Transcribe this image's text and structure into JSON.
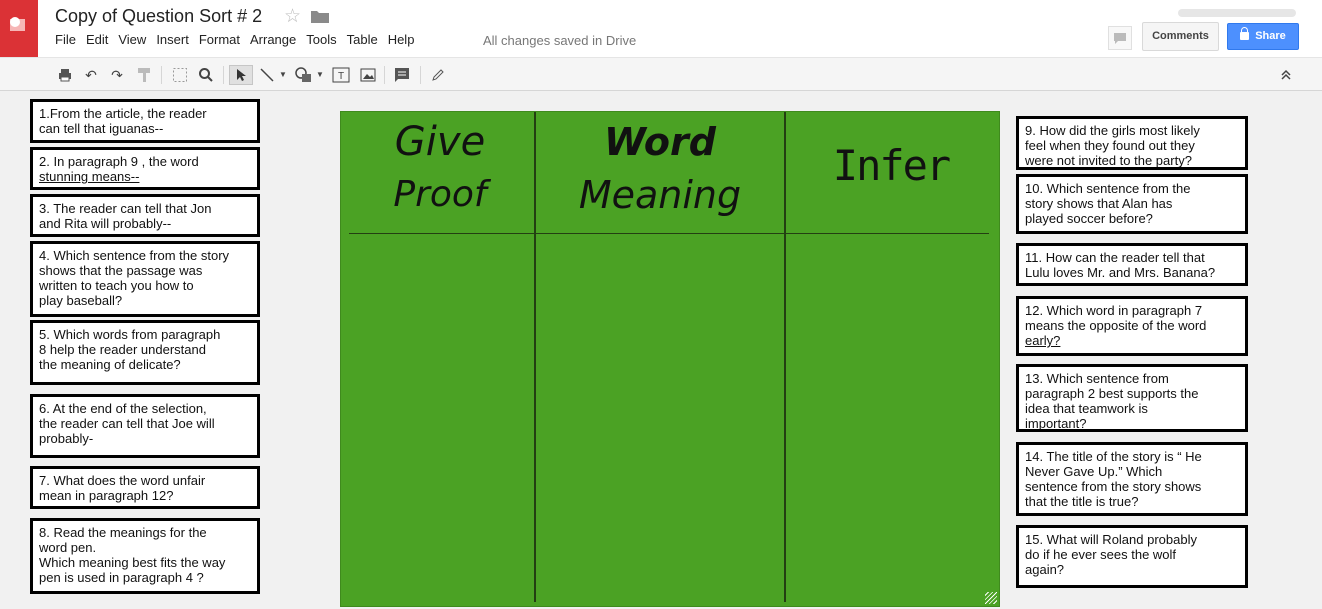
{
  "app": {
    "doc_title": "Copy of Question Sort # 2",
    "save_status": "All changes saved in Drive",
    "menu": [
      "File",
      "Edit",
      "View",
      "Insert",
      "Format",
      "Arrange",
      "Tools",
      "Table",
      "Help"
    ],
    "comments_label": "Comments",
    "share_label": "Share",
    "accent_color": "#4d90fe",
    "logo_color": "#db3236"
  },
  "toolbar": {
    "icons": [
      "print-icon",
      "undo-icon",
      "redo-icon",
      "paint-format-icon",
      "zoom-fit-icon",
      "zoom-icon",
      "select-icon",
      "line-icon",
      "shape-icon",
      "text-box-icon",
      "image-icon",
      "comment-icon",
      "pencil-icon",
      "collapse-icon"
    ]
  },
  "board": {
    "color": "#4ba224",
    "columns": [
      {
        "line1": "Give",
        "line2": "Proof"
      },
      {
        "line1": "Word",
        "line2": "Meaning"
      },
      {
        "line1": "Infer",
        "line2": ""
      }
    ]
  },
  "questions_left": [
    {
      "id": "q1",
      "lines": [
        "1.From the article, the reader",
        "can tell that iguanas--"
      ]
    },
    {
      "id": "q2",
      "lines": [
        "2. In paragraph 9 , the word",
        "stunning means--"
      ]
    },
    {
      "id": "q3",
      "lines": [
        "3. The reader can tell that Jon",
        "and Rita will probably--"
      ]
    },
    {
      "id": "q4",
      "lines": [
        "4. Which sentence from the story",
        "shows that the passage was",
        "written to teach you how to",
        "play baseball?"
      ]
    },
    {
      "id": "q5",
      "lines": [
        "5. Which words from paragraph",
        "8 help the reader understand",
        "the meaning of delicate?"
      ]
    },
    {
      "id": "q6",
      "lines": [
        "6. At the end of the selection,",
        "the reader can tell that Joe will",
        "probably-"
      ]
    },
    {
      "id": "q7",
      "lines": [
        "7. What does the word unfair",
        "mean in paragraph 12?"
      ]
    },
    {
      "id": "q8",
      "lines": [
        "8. Read the meanings for the",
        "word pen.",
        "Which meaning best fits the way",
        "pen is used in paragraph 4 ?"
      ]
    }
  ],
  "questions_right": [
    {
      "id": "q9",
      "lines": [
        "9. How did the girls most likely",
        "feel when they found out they",
        "were not invited to the party?"
      ]
    },
    {
      "id": "q10",
      "lines": [
        "10. Which sentence from the",
        "story shows that Alan has",
        "played soccer before?"
      ]
    },
    {
      "id": "q11",
      "lines": [
        "11. How can the reader tell that",
        "Lulu loves Mr. and Mrs. Banana?"
      ]
    },
    {
      "id": "q12",
      "lines": [
        "12. Which word in paragraph 7",
        "means the opposite of the word",
        "early?"
      ]
    },
    {
      "id": "q13",
      "lines": [
        "13. Which sentence from",
        "paragraph 2 best supports the",
        "idea that teamwork is",
        "important?"
      ]
    },
    {
      "id": "q14",
      "lines": [
        "14. The title of the story is “ He",
        "Never Gave Up.” Which",
        "sentence from the story shows",
        "that the title is true?"
      ]
    },
    {
      "id": "q15",
      "lines": [
        "15. What will Roland probably",
        "do if he ever sees the wolf",
        "again?"
      ]
    }
  ]
}
